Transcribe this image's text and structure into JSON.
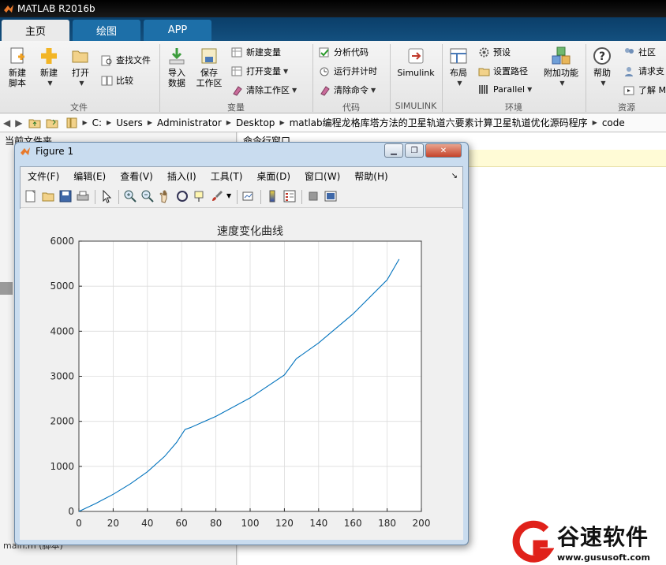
{
  "app": {
    "title": "MATLAB R2016b"
  },
  "tabs": [
    {
      "label": "主页"
    },
    {
      "label": "绘图"
    },
    {
      "label": "APP"
    }
  ],
  "ribbon": {
    "new_script": "新建\n脚本",
    "new": "新建",
    "open": "打开",
    "find_files": "查找文件",
    "compare": "比较",
    "import_data": "导入\n数据",
    "save_workspace": "保存\n工作区",
    "new_variable": "新建变量",
    "open_variable": "打开变量",
    "clear_workspace": "清除工作区",
    "analyze_code": "分析代码",
    "run_time": "运行并计时",
    "clear_commands": "清除命令",
    "simulink": "Simulink",
    "layout": "布局",
    "preferences": "预设",
    "set_path": "设置路径",
    "parallel": "Parallel",
    "addons": "附加功能",
    "help": "帮助",
    "community": "社区",
    "request_support": "请求支",
    "learn": "了解 M",
    "sections": {
      "file": "文件",
      "variable": "变量",
      "code": "代码",
      "simulink": "SIMULINK",
      "environment": "环境",
      "resources": "资源"
    }
  },
  "address": {
    "crumbs": [
      "C:",
      "Users",
      "Administrator",
      "Desktop",
      "matlab编程龙格库塔方法的卫星轨道六要素计算卫星轨道优化源码程序",
      "code"
    ]
  },
  "panels": {
    "current_folder": "当前文件夹",
    "command_window": "命令行窗口",
    "file_entry": "main.m (脚本)"
  },
  "figure": {
    "title": "Figure 1",
    "menu": [
      "文件(F)",
      "编辑(E)",
      "查看(V)",
      "插入(I)",
      "工具(T)",
      "桌面(D)",
      "窗口(W)",
      "帮助(H)"
    ]
  },
  "chart_data": {
    "type": "line",
    "title": "速度变化曲线",
    "xlabel": "",
    "ylabel": "",
    "xlim": [
      0,
      200
    ],
    "ylim": [
      0,
      6000
    ],
    "xticks": [
      0,
      20,
      40,
      60,
      80,
      100,
      120,
      140,
      160,
      180,
      200
    ],
    "yticks": [
      0,
      1000,
      2000,
      3000,
      4000,
      5000,
      6000
    ],
    "grid": true,
    "color": "#0072bd",
    "x": [
      0,
      10,
      20,
      30,
      40,
      50,
      57,
      62,
      65,
      80,
      100,
      120,
      127,
      140,
      160,
      180,
      187
    ],
    "y": [
      0,
      180,
      380,
      610,
      880,
      1220,
      1530,
      1820,
      1860,
      2110,
      2520,
      3030,
      3390,
      3740,
      4380,
      5140,
      5600
    ]
  },
  "watermark": {
    "text": "谷速软件",
    "url": "www.gususoft.com",
    "color": "#e0211a"
  }
}
